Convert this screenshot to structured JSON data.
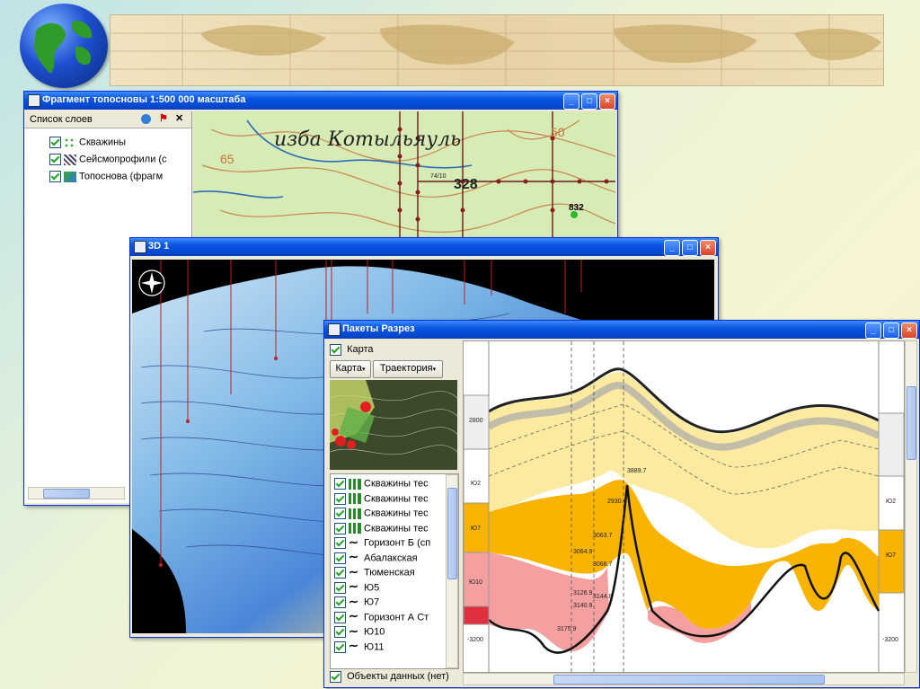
{
  "window_map": {
    "title": "Фрагмент топосновы 1:500 000 масштаба",
    "panel_title": "Список слоев",
    "layers": [
      {
        "label": "Скважины"
      },
      {
        "label": "Сейсмопрофили (с"
      },
      {
        "label": "Топоснова (фрагм"
      }
    ],
    "map_text": "изба Котыльяуль",
    "map_numbers": {
      "n328": "328",
      "n832": "832",
      "n50": "50",
      "n65": "65",
      "n7410": "74/10"
    }
  },
  "window_3d": {
    "title": "3D 1"
  },
  "window_section": {
    "title": "Пакеты Разрез",
    "map_checkbox_label": "Карта",
    "buttons": [
      {
        "label": "Карта"
      },
      {
        "label": "Траектория"
      }
    ],
    "layers": [
      {
        "label": "Скважины тес",
        "type": "well"
      },
      {
        "label": "Скважины тес",
        "type": "well"
      },
      {
        "label": "Скважины тес",
        "type": "well"
      },
      {
        "label": "Скважины тес",
        "type": "well"
      },
      {
        "label": "Горизонт Б (сп",
        "type": "horizon"
      },
      {
        "label": "Абалакская",
        "type": "horizon"
      },
      {
        "label": "Тюменская",
        "type": "horizon"
      },
      {
        "label": "Ю5",
        "type": "horizon"
      },
      {
        "label": "Ю7",
        "type": "horizon"
      },
      {
        "label": "Горизонт А Ст",
        "type": "horizon"
      },
      {
        "label": "Ю10",
        "type": "horizon"
      },
      {
        "label": "Ю11",
        "type": "horizon"
      }
    ],
    "data_objects_label": "Объекты данных (нет)",
    "section_labels": {
      "left_depth": "-3200",
      "right_depth": "-3200",
      "top_left": "2800",
      "yu2": "Ю2",
      "yu7_left": "Ю7",
      "yu10": "Ю10",
      "yu7_right": "Ю7",
      "yu2_right": "Ю2",
      "v3889": "3889.7",
      "v2930": "2930.4",
      "v3063": "3063.7",
      "v3068": "3068.7",
      "v3064": "3064.9",
      "v3126": "3126.9",
      "v3140": "3140.9",
      "v3144": "3144.8",
      "v3175": "3175.9"
    }
  },
  "colors": {
    "titlebar": "#0a55e0",
    "close": "#d8442a",
    "yellow": "#fbe07a",
    "orange": "#f8b400",
    "pink": "#f4a0a0"
  }
}
